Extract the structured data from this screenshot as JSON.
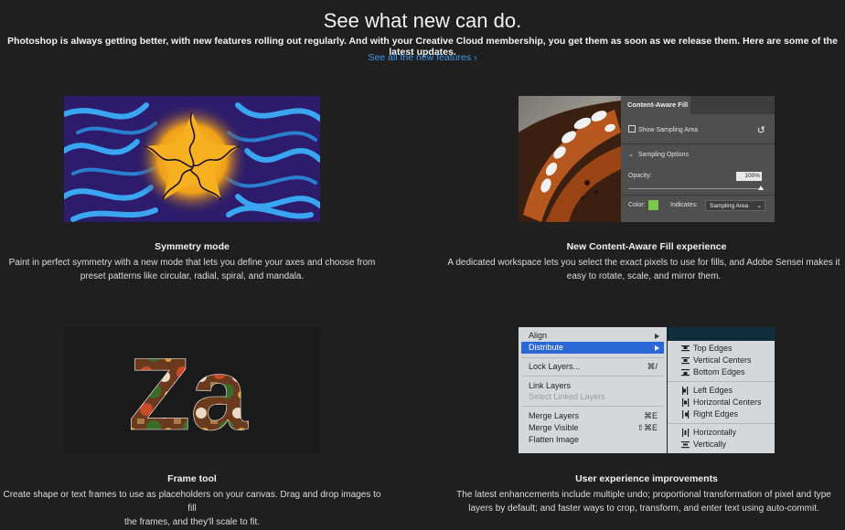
{
  "hero": {
    "title": "See what new can do.",
    "subtitle": "Photoshop is always getting better, with new features rolling out regularly. And with your Creative Cloud membership, you get them as soon as we release them. Here are some of the latest updates.",
    "link": "See all the new features ›"
  },
  "features": [
    {
      "title": "Symmetry mode",
      "desc_line1": "Paint in perfect symmetry with a new mode that lets you define your axes and choose from",
      "desc_line2": "preset patterns like circular, radial, spiral, and mandala."
    },
    {
      "title": "New Content-Aware Fill experience",
      "desc_line1": "A dedicated workspace lets you select the exact pixels to use for fills, and Adobe Sensei makes it",
      "desc_line2": "easy to rotate, scale, and mirror them."
    },
    {
      "title": "Frame tool",
      "desc_line1": "Create shape or text frames to use as placeholders on your canvas. Drag and drop images to fill",
      "desc_line2": "the frames, and they'll scale to fit."
    },
    {
      "title": "User experience improvements",
      "desc_line1": "The latest enhancements include multiple undo; proportional transformation of pixel and type",
      "desc_line2": "layers by default; and faster ways to crop, transform, and enter text using auto-commit."
    }
  ],
  "frame_image": {
    "text": "Za"
  },
  "caf_panel": {
    "tab": "Content-Aware Fill",
    "show_sampling": "Show Sampling Area",
    "sampling_options": "Sampling Options",
    "opacity_label": "Opacity:",
    "opacity_value": "100%",
    "color_label": "Color:",
    "indicates_label": "Indicates:",
    "indicates_value": "Sampling Area",
    "swatch_color": "#7cc84c"
  },
  "menu": {
    "items": [
      {
        "label": "Align"
      },
      {
        "label": "Distribute"
      },
      {
        "label": "Lock Layers...",
        "shortcut": "⌘/"
      },
      {
        "label": "Link Layers"
      },
      {
        "label": "Select Linked Layers"
      },
      {
        "label": "Merge Layers",
        "shortcut": "⌘E"
      },
      {
        "label": "Merge Visible",
        "shortcut": "⇧⌘E"
      },
      {
        "label": "Flatten Image"
      }
    ],
    "submenu": [
      {
        "label": "Top Edges"
      },
      {
        "label": "Vertical Centers"
      },
      {
        "label": "Bottom Edges"
      },
      {
        "label": "Left Edges"
      },
      {
        "label": "Horizontal Centers"
      },
      {
        "label": "Right Edges"
      },
      {
        "label": "Horizontally"
      },
      {
        "label": "Vertically"
      }
    ],
    "highlight_color": "#2c67d6"
  },
  "colors": {
    "background": "#1f1f1f",
    "link": "#3e9cf0"
  }
}
